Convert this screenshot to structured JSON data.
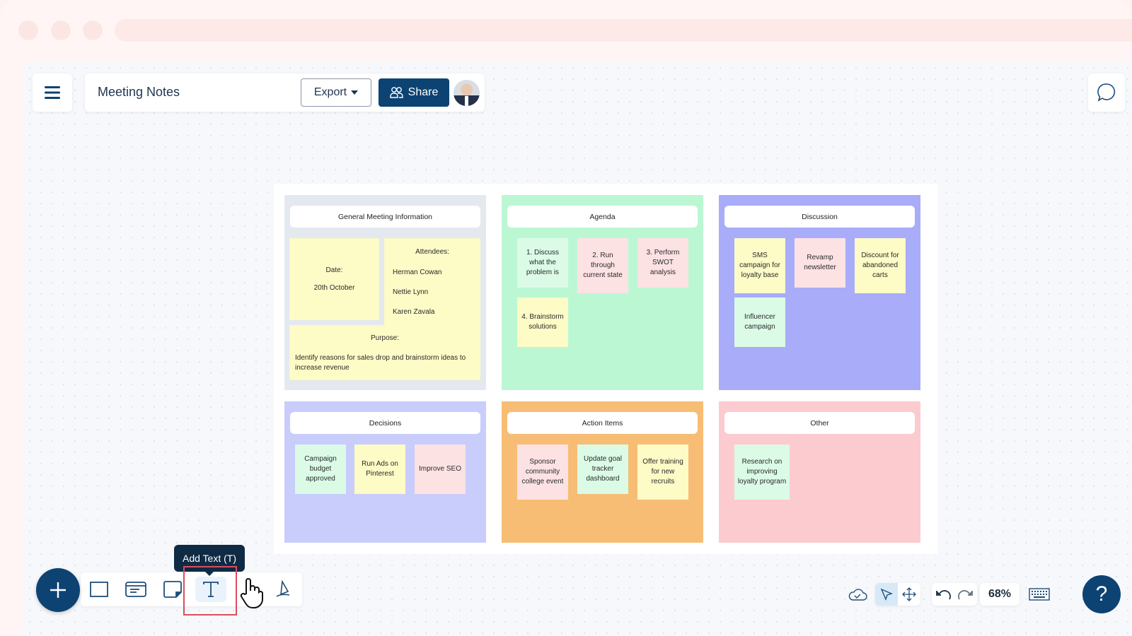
{
  "header": {
    "doc_title": "Meeting Notes",
    "export_label": "Export",
    "share_label": "Share"
  },
  "board": {
    "sections": [
      {
        "title": "General Meeting Information",
        "date_label": "Date:",
        "date_value": "20th October",
        "attendees_label": "Attendees:",
        "attendees": [
          "Herman Cowan",
          "Nettie Lynn",
          "Karen Zavala"
        ],
        "purpose_label": "Purpose:",
        "purpose_text": "Identify reasons for sales drop and brainstorm ideas to increase revenue",
        "color": "#e4e8ef"
      },
      {
        "title": "Agenda",
        "color": "#bbf7d3",
        "notes": [
          "1. Discuss what the problem is",
          "2. Run through current state",
          "3. Perform SWOT analysis",
          "4. Brainstorm solutions"
        ]
      },
      {
        "title": "Discussion",
        "color": "#a8acf9",
        "notes": [
          "SMS campaign for loyalty base",
          "Revamp newsletter",
          "Discount for abandoned carts",
          "Influencer campaign"
        ]
      },
      {
        "title": "Decisions",
        "color": "#c8cdfb",
        "notes": [
          "Campaign budget approved",
          "Run Ads on Pinterest",
          "Improve SEO"
        ]
      },
      {
        "title": "Action Items",
        "color": "#f7bd74",
        "notes": [
          "Sponsor community college event",
          "Update goal tracker dashboard",
          "Offer training for new recruits"
        ]
      },
      {
        "title": "Other",
        "color": "#fccbd0",
        "notes": [
          "Research on improving loyalty program"
        ]
      }
    ]
  },
  "toolbar": {
    "tooltip": "Add Text (T)",
    "tools": [
      "rectangle",
      "card",
      "sticky-note",
      "text",
      "pan",
      "pen"
    ]
  },
  "bottom_right": {
    "zoom_level": "68%"
  },
  "colors": {
    "brand": "#0d4373",
    "highlight": "#d94e5e"
  }
}
